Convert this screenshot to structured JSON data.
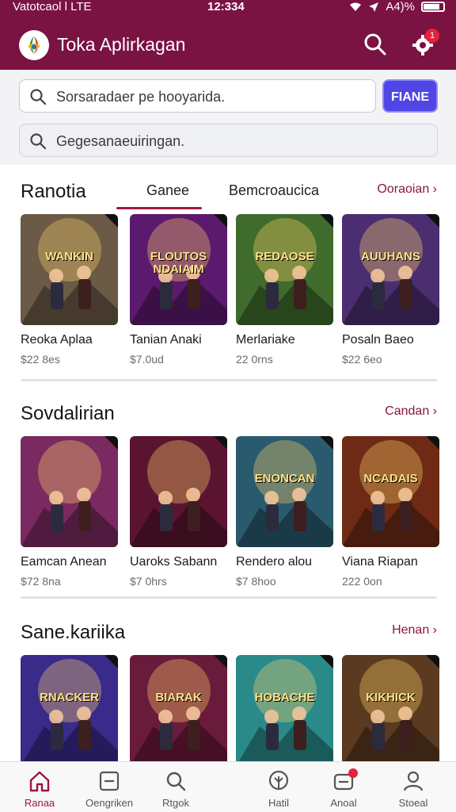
{
  "status_bar": {
    "carrier": "Vatotcaol l LTE",
    "time": "12:334",
    "battery": "A4)%"
  },
  "app_bar": {
    "title": "Toka Aplirkagan",
    "search_icon": "search-icon",
    "settings_icon": "gear-icon",
    "notification_count": "1",
    "accent_color": "#7a1242"
  },
  "search": {
    "primary_placeholder": "Sorsaradaer pe hooyarida.",
    "primary_button": "FIANE",
    "secondary_placeholder": "Gegesanaeuiringan."
  },
  "featured": {
    "title": "Ranotia",
    "tabs": [
      {
        "label": "Ganee",
        "active": true
      },
      {
        "label": "Bemcroaucica",
        "active": false
      }
    ],
    "more_label": "Ooraoian",
    "items": [
      {
        "name": "Reoka Aplaa",
        "price": "$22 8es",
        "cover_text": "WANKIN",
        "bg": "#6b5a45"
      },
      {
        "name": "Tanian Anaki",
        "price": "$7.0ud",
        "cover_text": "FLOUTOS NDAIAIM",
        "bg": "#5b1a6e"
      },
      {
        "name": "Merlariake",
        "price": "22 0rns",
        "cover_text": "REDAOSE",
        "bg": "#3f6b2c"
      },
      {
        "name": "Posaln Baeo",
        "price": "$22 6eo",
        "cover_text": "AUUHANS",
        "bg": "#4a2e70"
      }
    ]
  },
  "section_two": {
    "title": "Sovdalirian",
    "more_label": "Candan",
    "items": [
      {
        "name": "Eamcan Anean",
        "price": "$72 8na",
        "cover_text": "",
        "bg": "#7a2a60"
      },
      {
        "name": "Uaroks Sabann",
        "price": "$7 0hrs",
        "cover_text": "",
        "bg": "#5a1430"
      },
      {
        "name": "Rendero alou",
        "price": "$7 8hoo",
        "cover_text": "ENONCAN",
        "bg": "#2a5a6e"
      },
      {
        "name": "Viana Riapan",
        "price": "222 0on",
        "cover_text": "NCADAIS",
        "bg": "#6e2a14"
      }
    ]
  },
  "section_three": {
    "title": "Sane.kariika",
    "more_label": "Henan",
    "items": [
      {
        "cover_text": "RNACKER",
        "bg": "#3a2a8a"
      },
      {
        "cover_text": "BIARAK",
        "bg": "#6a1a3a"
      },
      {
        "cover_text": "HOBACHE",
        "bg": "#2a8a8a"
      },
      {
        "cover_text": "KIKHICK",
        "bg": "#5a3a20"
      }
    ]
  },
  "bottom_nav": [
    {
      "label": "Ranaa",
      "icon": "home-icon",
      "active": true
    },
    {
      "label": "Oengriken",
      "icon": "minus-box-icon",
      "active": false
    },
    {
      "label": "Rtgok",
      "icon": "search-icon",
      "active": false
    },
    {
      "label": "Hatil",
      "icon": "leaf-icon",
      "active": false
    },
    {
      "label": "Anoal",
      "icon": "inbox-icon",
      "active": false
    },
    {
      "label": "Stoeal",
      "icon": "person-icon",
      "active": false
    }
  ]
}
